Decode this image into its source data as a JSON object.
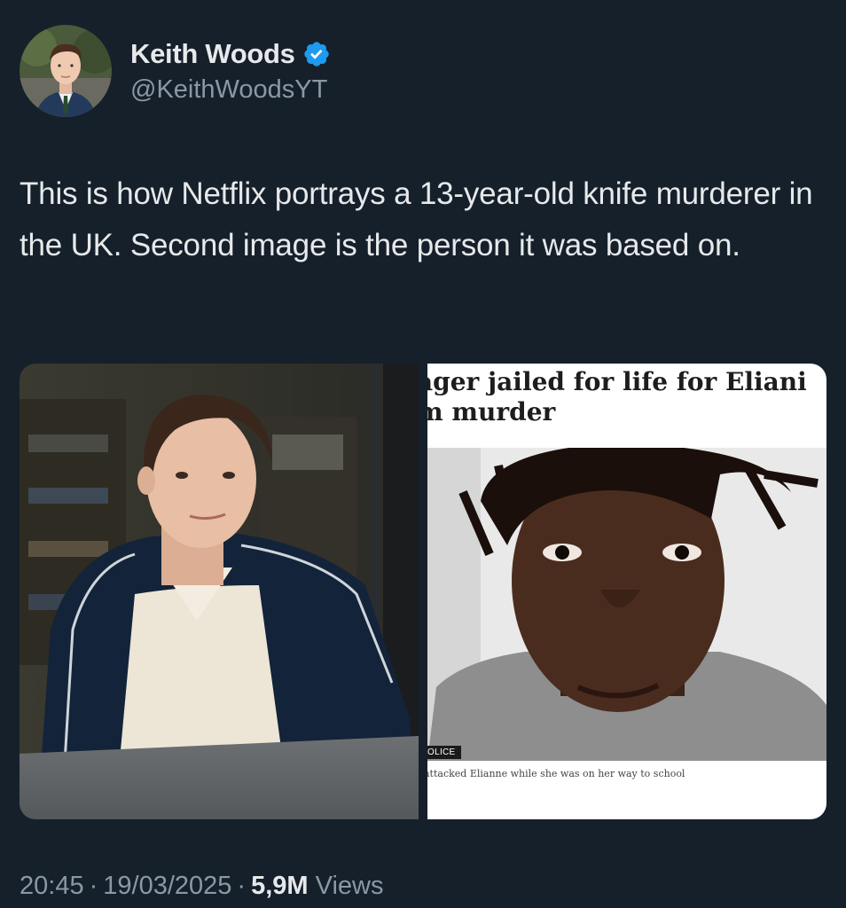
{
  "author": {
    "display_name": "Keith Woods",
    "handle": "@KeithWoodsYT",
    "verified": true,
    "avatar_icon": "profile-photo",
    "verified_color": "#1d9bf0"
  },
  "tweet": {
    "text": "This is how Netflix portrays a 13-year-old knife murderer in the UK. Second image is the person it was based on."
  },
  "media": {
    "left_image": "tv-still-boy-in-track-jacket",
    "right_image": {
      "headline_line1": "ager jailed for life for Eliani",
      "headline_line2": "m murder",
      "credit": "OLICE",
      "caption": "attacked Elianne while she was on her way to school"
    }
  },
  "meta": {
    "time": "20:45",
    "date": "19/03/2025",
    "views_count": "5,9M",
    "views_label": "Views",
    "separator": "·"
  },
  "colors": {
    "background": "#15202b",
    "text_primary": "#e7e9ea",
    "text_secondary": "#8b98a5"
  }
}
